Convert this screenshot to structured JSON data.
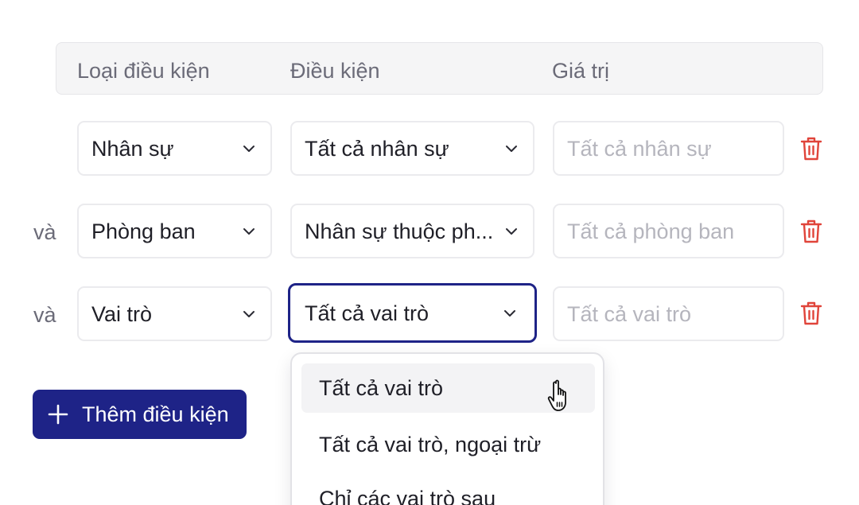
{
  "header": {
    "col_type": "Loại điều kiện",
    "col_condition": "Điều kiện",
    "col_value": "Giá trị"
  },
  "rows": [
    {
      "conjunction": "",
      "type": "Nhân sự",
      "condition": "Tất cả nhân sự",
      "value_placeholder": "Tất cả nhân sự"
    },
    {
      "conjunction": "và",
      "type": "Phòng ban",
      "condition": "Nhân sự thuộc ph...",
      "value_placeholder": "Tất cả phòng ban"
    },
    {
      "conjunction": "và",
      "type": "Vai trò",
      "condition": "Tất cả vai trò",
      "value_placeholder": "Tất cả vai trò"
    }
  ],
  "add_button": {
    "label": "Thêm điều kiện"
  },
  "dropdown": {
    "options": [
      "Tất cả vai trò",
      "Tất cả vai trò, ngoại trừ",
      "Chỉ các vai trò sau"
    ],
    "hovered_index": 0
  },
  "colors": {
    "accent": "#1e2387",
    "delete": "#e0443a",
    "muted_text": "#6b6b78",
    "placeholder": "#b5b5bd"
  },
  "icons": [
    "chevron-down-icon",
    "trash-icon",
    "plus-icon",
    "hand-pointer-cursor-icon"
  ]
}
